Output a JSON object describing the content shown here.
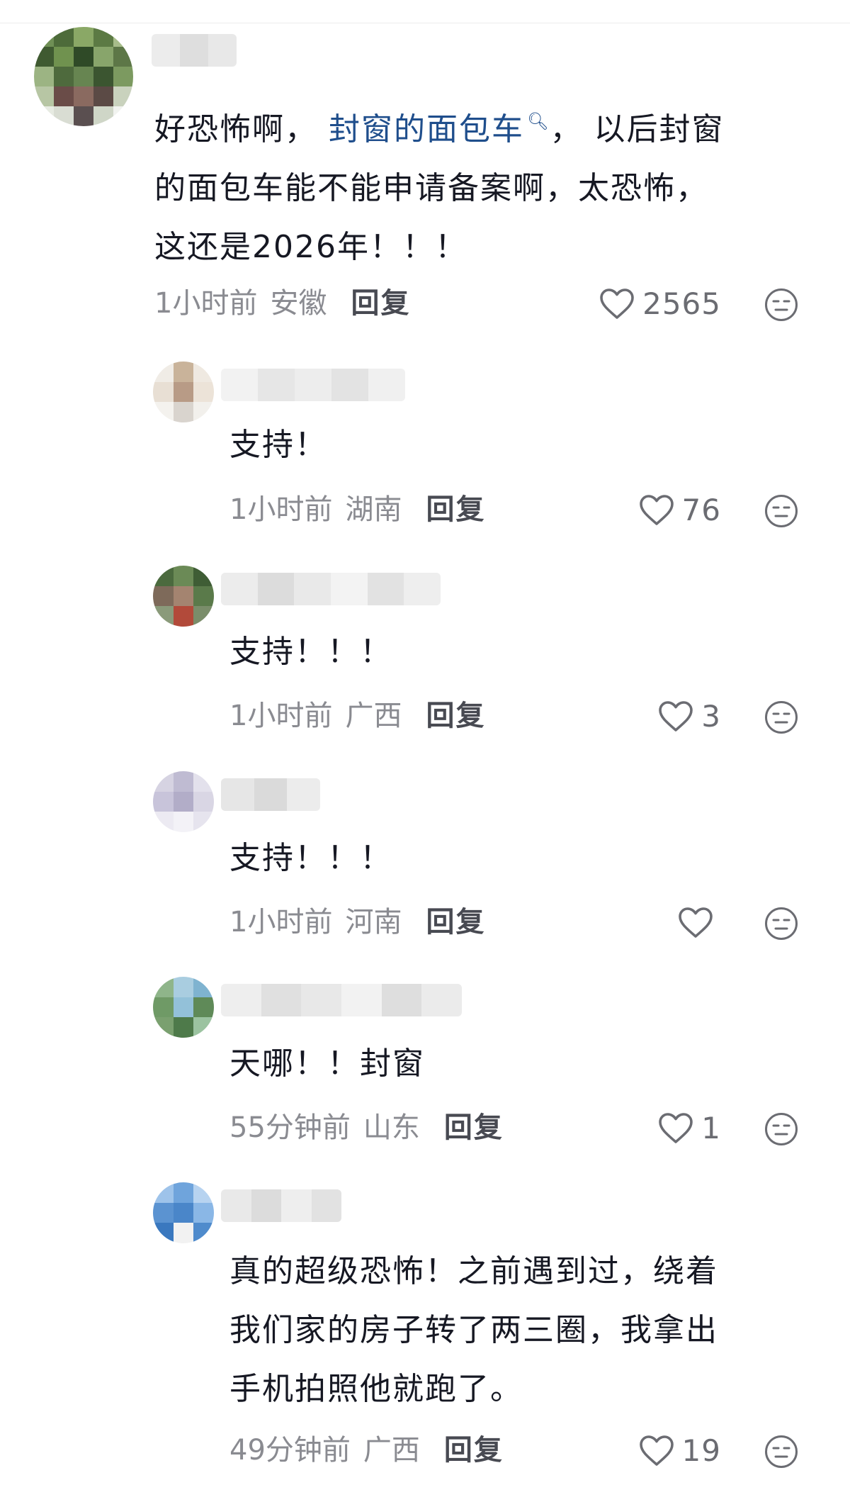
{
  "comments": [
    {
      "content_before": "好恐怖啊， ",
      "topic": "封窗的面包车",
      "content_after": "， 以后封窗\n的面包车能不能申请备案啊，太恐怖，\n这还是2026年！！！",
      "time": "1小时前",
      "region": "安徽",
      "reply_label": "回复",
      "likes": "2565"
    }
  ],
  "replies": [
    {
      "content": "支持！",
      "time": "1小时前",
      "region": "湖南",
      "reply_label": "回复",
      "likes": "76"
    },
    {
      "content": "支持！！！",
      "time": "1小时前",
      "region": "广西",
      "reply_label": "回复",
      "likes": "3"
    },
    {
      "content": "支持！！！",
      "time": "1小时前",
      "region": "河南",
      "reply_label": "回复",
      "likes": ""
    },
    {
      "content": "天哪！！封窗",
      "time": "55分钟前",
      "region": "山东",
      "reply_label": "回复",
      "likes": "1"
    },
    {
      "content": "真的超级恐怖！之前遇到过，绕着\n我们家的房子转了两三圈，我拿出\n手机拍照他就跑了。",
      "time": "49分钟前",
      "region": "广西",
      "reply_label": "回复",
      "likes": "19"
    }
  ],
  "icons": {
    "like": "heart-outline-icon",
    "dislike": "meh-face-icon",
    "topic_search": "search-icon"
  },
  "colors": {
    "text": "#161823",
    "meta": "#8a8b91",
    "topic_link": "#1f4e8c",
    "icon": "#6b6c72"
  }
}
